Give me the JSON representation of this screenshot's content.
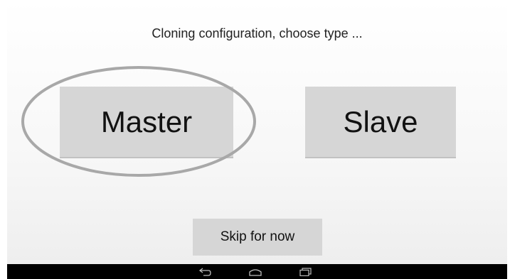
{
  "dialog": {
    "prompt": "Cloning configuration, choose type ...",
    "master_label": "Master",
    "slave_label": "Slave",
    "skip_label": "Skip for now"
  },
  "annotation": {
    "highlight_color": "#a8a8a8"
  },
  "navbar": {
    "icons": [
      "back-icon",
      "home-icon",
      "recent-apps-icon"
    ]
  }
}
